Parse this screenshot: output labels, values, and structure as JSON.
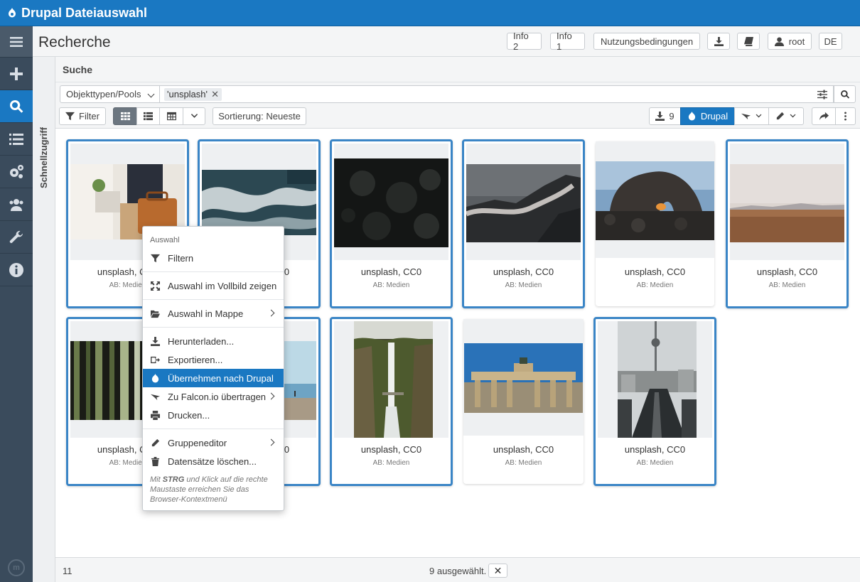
{
  "app": {
    "title": "Drupal Dateiauswahl"
  },
  "sidebar": {
    "items": [
      "menu",
      "add",
      "search",
      "list",
      "settings",
      "users",
      "tools",
      "info"
    ]
  },
  "quick_access": "Schnellzugriff",
  "header": {
    "page_title": "Recherche",
    "buttons": {
      "info2": "Info 2",
      "info1": "Info 1",
      "terms": "Nutzungsbedingungen",
      "user": "root",
      "lang": "DE"
    }
  },
  "search": {
    "section_title": "Suche",
    "object_types": "Objekttypen/Pools",
    "chip": "'unsplash'"
  },
  "toolbar": {
    "filter": "Filter",
    "sort": "Sortierung: Neueste",
    "download_count": "9",
    "drupal": "Drupal"
  },
  "cards": [
    {
      "caption": "unsplash, CC0",
      "sub": "AB: Medien",
      "selected": true
    },
    {
      "caption": "unsplash, CC0",
      "sub": "AB: Medien",
      "selected": true
    },
    {
      "caption": "unsplash, CC0",
      "sub": "AB: Medien",
      "selected": true
    },
    {
      "caption": "unsplash, CC0",
      "sub": "AB: Medien",
      "selected": true
    },
    {
      "caption": "unsplash, CC0",
      "sub": "AB: Medien",
      "selected": false
    },
    {
      "caption": "unsplash, CC0",
      "sub": "AB: Medien",
      "selected": true
    },
    {
      "caption": "unsplash, CC0",
      "sub": "AB: Medien",
      "selected": true
    },
    {
      "caption": "unsplash, CC0",
      "sub": "AB: Medien",
      "selected": true
    },
    {
      "caption": "unsplash, CC0",
      "sub": "AB: Medien",
      "selected": true
    },
    {
      "caption": "unsplash, CC0",
      "sub": "AB: Medien",
      "selected": false
    },
    {
      "caption": "unsplash, CC0",
      "sub": "AB: Medien",
      "selected": true
    }
  ],
  "context_menu": {
    "header": "Auswahl",
    "items": {
      "filter": "Filtern",
      "fullscreen": "Auswahl im Vollbild zeigen",
      "folder": "Auswahl in Mappe",
      "download": "Herunterladen...",
      "export": "Exportieren...",
      "drupal": "Übernehmen nach Drupal",
      "falcon": "Zu Falcon.io übertragen",
      "print": "Drucken...",
      "group": "Gruppeneditor",
      "delete": "Datensätze löschen..."
    },
    "hint_prefix": "Mit",
    "hint_key": "STRG",
    "hint_suffix": "und Klick auf die rechte Maustaste erreichen Sie das Browser-Kontextmenü"
  },
  "footer": {
    "count": "11",
    "selected_text": "9 ausgewählt.",
    "clear": "✕"
  },
  "colors": {
    "primary": "#1a78c2",
    "sidebar": "#3a4b5c",
    "selection": "#3a85c6"
  }
}
